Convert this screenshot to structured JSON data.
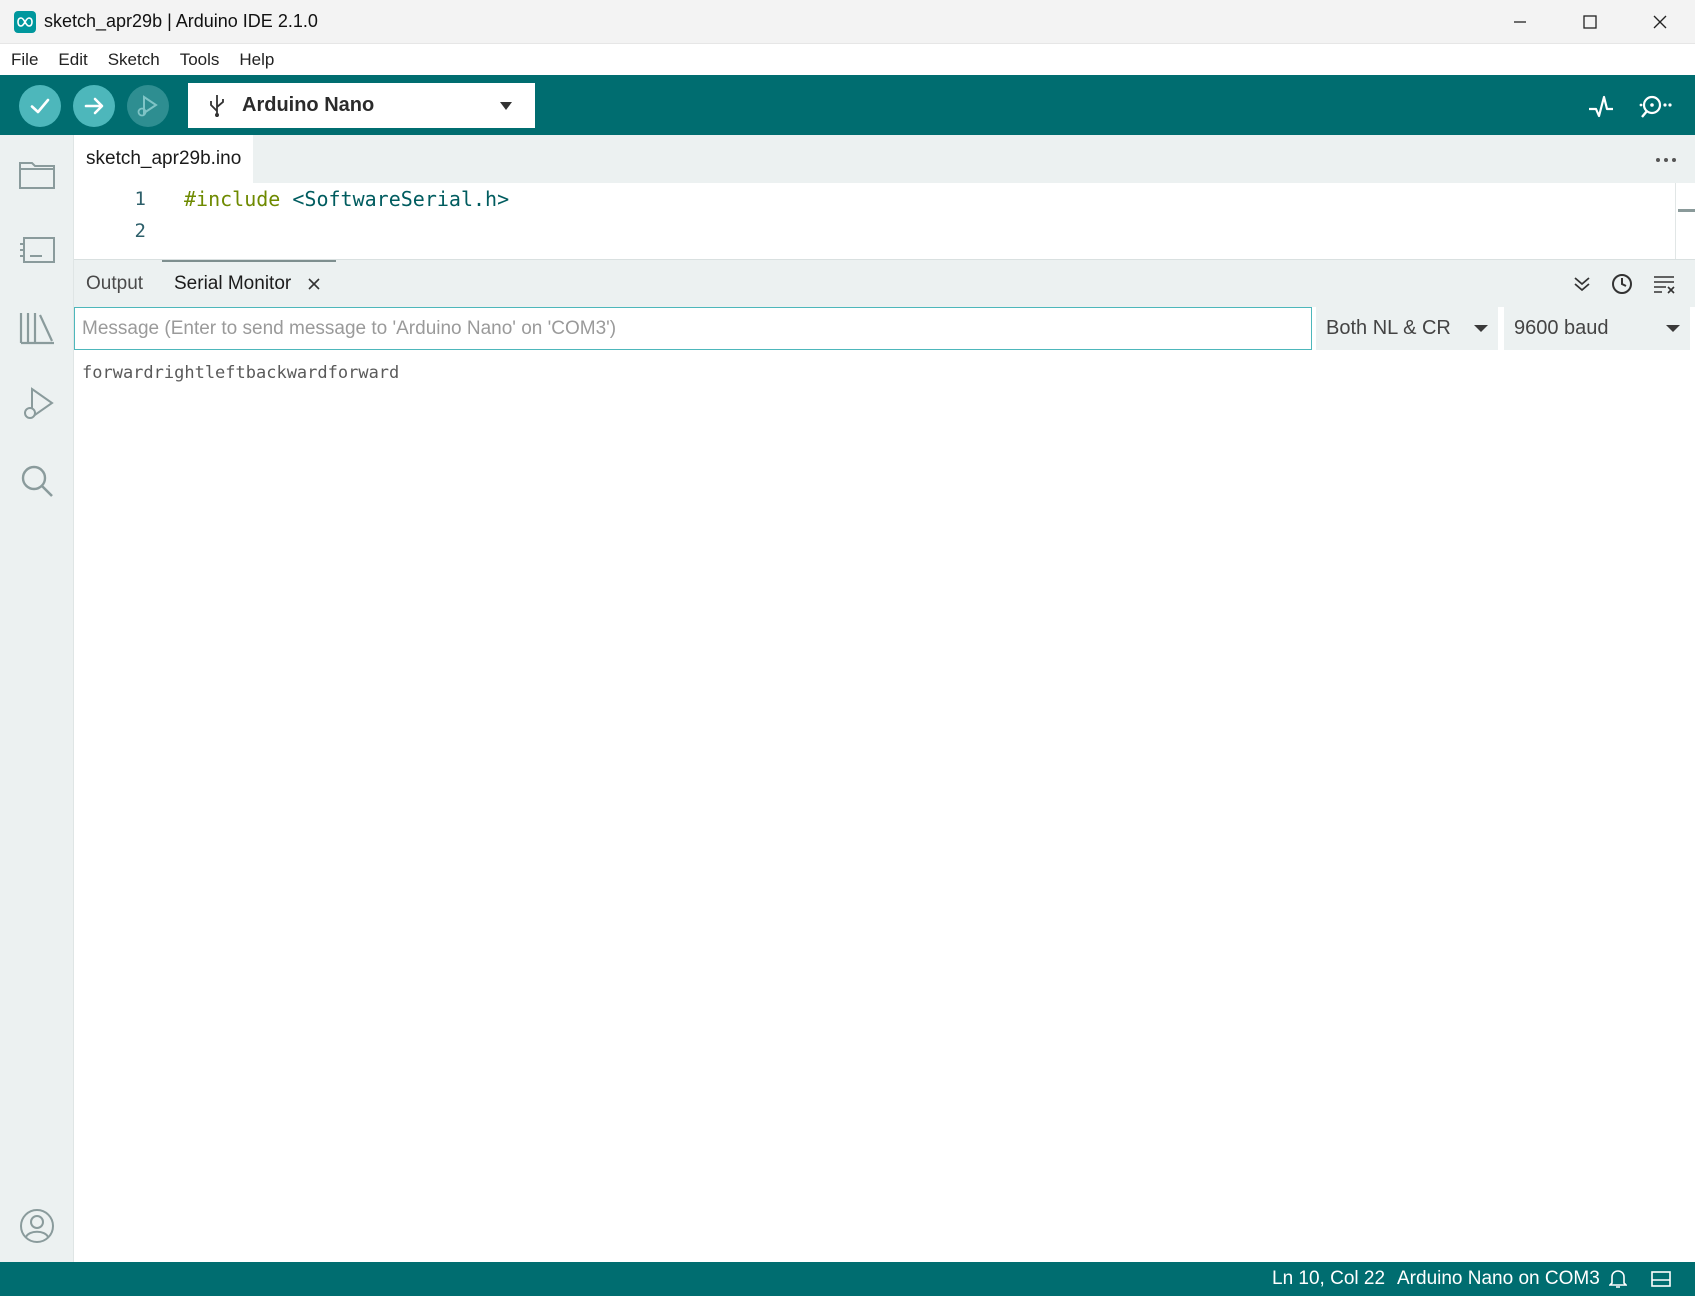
{
  "window": {
    "title": "sketch_apr29b | Arduino IDE 2.1.0",
    "logo_icon": "arduino-infinity-icon"
  },
  "menu": {
    "items": [
      "File",
      "Edit",
      "Sketch",
      "Tools",
      "Help"
    ]
  },
  "toolbar": {
    "verify_icon": "check-icon",
    "upload_icon": "arrow-right-icon",
    "debug_icon": "debug-icon",
    "board_icon": "usb-icon",
    "board_name": "Arduino Nano",
    "plotter_icon": "serial-plotter-icon",
    "monitor_icon": "serial-monitor-icon",
    "accent_color": "#006d70"
  },
  "sidebar": {
    "items": [
      "folder-icon",
      "boards-manager-icon",
      "library-icon",
      "debug-icon",
      "search-icon"
    ],
    "account_icon": "account-icon"
  },
  "editor": {
    "file_tab": "sketch_apr29b.ino",
    "lines": [
      {
        "number": "1",
        "keyword": "#include",
        "rest": " <SoftwareSerial.h>"
      },
      {
        "number": "2",
        "keyword": "",
        "rest": ""
      }
    ]
  },
  "panel": {
    "tabs": [
      "Output",
      "Serial Monitor"
    ],
    "active_tab": "Serial Monitor"
  },
  "monitor": {
    "message_placeholder": "Message (Enter to send message to 'Arduino Nano' on 'COM3')",
    "line_ending": "Both NL & CR",
    "baud": "9600 baud",
    "output": "forwardrightleftbackwardforward"
  },
  "status": {
    "position": "Ln 10, Col 22",
    "board_port": "Arduino Nano on COM3"
  }
}
